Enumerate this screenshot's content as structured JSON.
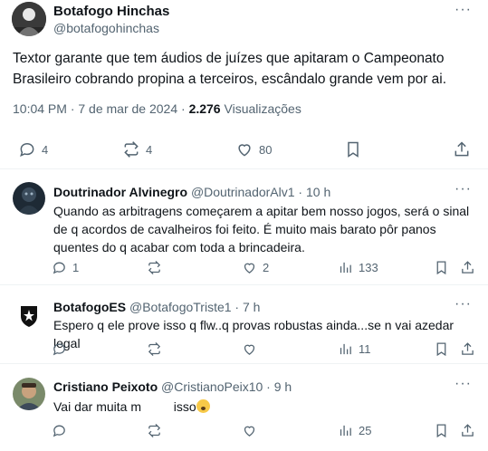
{
  "post": {
    "author_name": "Botafogo Hinchas",
    "author_handle": "@botafogohinchas",
    "text": "Textor garante que tem áudios de juízes que apitaram o Campeonato Brasileiro cobrando propina a terceiros, escândalo grande vem por ai.",
    "time": "10:04 PM · 7 de mar de 2024 · ",
    "views": "2.276",
    "views_label": " Visualizações",
    "replies": "4",
    "reposts": "4",
    "likes": "80",
    "more_icon": "···"
  },
  "replies": [
    {
      "name": "Doutrinador Alvinegro",
      "handle": "@DoutrinadorAlv1 · 10 h",
      "text": "Quando as arbitragens começarem a apitar bem nosso jogos, será o sinal de q acordos de cavalheiros foi feito. É muito mais barato pôr panos quentes do q acabar com toda a brincadeira.",
      "replies": "1",
      "reposts": "",
      "likes": "2",
      "views": "133"
    },
    {
      "name": "BotafogoES",
      "handle": "@BotafogoTriste1 · 7 h",
      "text": "Espero q ele prove isso q flw..q provas robustas ainda...se n vai azedar legal",
      "replies": "",
      "reposts": "",
      "likes": "",
      "views": "11"
    },
    {
      "name": "Cristiano Peixoto",
      "handle": "@CristianoPeix10 · 9 h",
      "text_before": "Vai dar muita m",
      "text_after": "isso",
      "replies": "",
      "reposts": "",
      "likes": "",
      "views": "25"
    }
  ],
  "colors": {
    "text": "#0f1419",
    "secondary": "#536471",
    "divider": "#eff3f4"
  }
}
